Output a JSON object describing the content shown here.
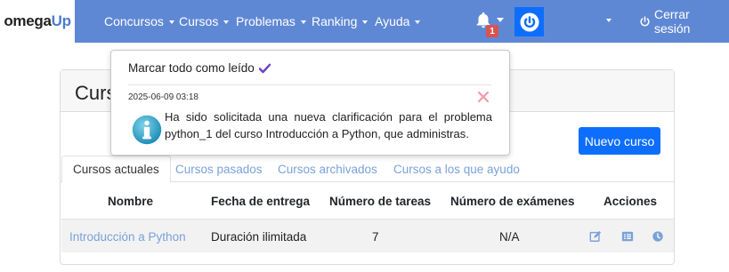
{
  "brand": {
    "prefix": "omega",
    "suffix": "Up"
  },
  "nav": {
    "items": [
      {
        "label": "Concursos"
      },
      {
        "label": "Cursos"
      },
      {
        "label": "Problemas"
      },
      {
        "label": "Ranking"
      },
      {
        "label": "Ayuda"
      }
    ],
    "notification_count": "1",
    "logout_label": "Cerrar sesión"
  },
  "card": {
    "title": "Cursos",
    "new_course_label": "Nuevo curso",
    "tabs": [
      {
        "label": "Cursos actuales",
        "active": true
      },
      {
        "label": "Cursos pasados",
        "active": false
      },
      {
        "label": "Cursos archivados",
        "active": false
      },
      {
        "label": "Cursos a los que ayudo",
        "active": false
      }
    ],
    "table": {
      "headers": [
        "Nombre",
        "Fecha de entrega",
        "Número de tareas",
        "Número de exámenes",
        "Acciones"
      ],
      "rows": [
        {
          "name": "Introducción a Python",
          "due": "Duración ilimitada",
          "tasks": "7",
          "exams": "N/A"
        }
      ]
    }
  },
  "notifications": {
    "mark_all_label": "Marcar todo como leído",
    "items": [
      {
        "timestamp": "2025-06-09 03:18",
        "message": "Ha sido solicitada una nueva clarificación para el problema python_1 del curso Introducción a Python, que administras."
      }
    ]
  },
  "colors": {
    "navbar": "#5f88d4",
    "primary_button": "#0d6efd",
    "link": "#7aa1d8",
    "badge": "#d9534f",
    "check": "#6f42c1",
    "close": "#f19aa9"
  },
  "icons": [
    "bell-icon",
    "power-icon",
    "check-icon",
    "close-icon",
    "info-icon",
    "edit-icon",
    "list-icon",
    "clock-icon"
  ]
}
